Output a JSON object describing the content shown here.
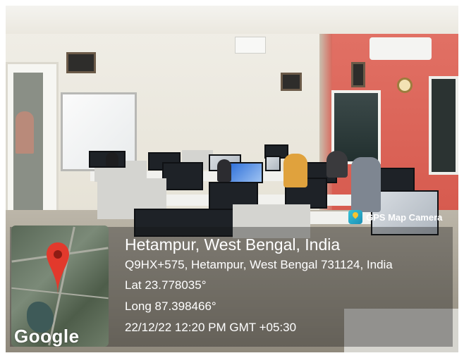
{
  "photo": {
    "scene": "computer-lab-classroom"
  },
  "badge": {
    "label": "GPS Map Camera",
    "icon": "gps-map-camera-icon"
  },
  "map": {
    "brand": "Google",
    "pin_icon": "map-pin-icon"
  },
  "location": {
    "place": "Hetampur, West Bengal, India",
    "address": "Q9HX+575, Hetampur, West Bengal 731124, India",
    "lat": "Lat 23.778035°",
    "long": "Long 87.398466°",
    "datetime": "22/12/22 12:20 PM GMT +05:30"
  },
  "colors": {
    "pin": "#e2392c",
    "overlay_text": "#ffffff",
    "wall_accent": "#d65a4e"
  }
}
